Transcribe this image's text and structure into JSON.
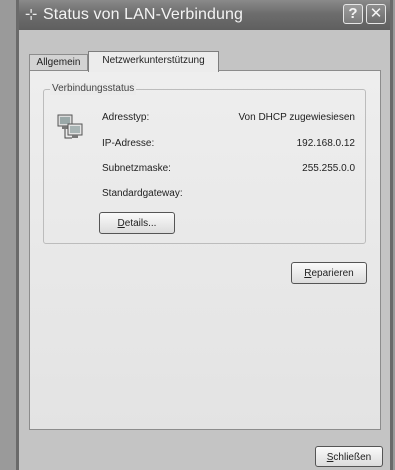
{
  "window": {
    "title": "Status von LAN-Verbindung",
    "help_label": "?",
    "close_label": "✕"
  },
  "tabs": [
    {
      "label": "Allgemein",
      "active": false
    },
    {
      "label": "Netzwerkunterstützung",
      "active": true
    }
  ],
  "connection_status": {
    "group_label": "Verbindungsstatus",
    "rows": [
      {
        "label": "Adresstyp:",
        "value": "Von DHCP zugewiesiesen"
      },
      {
        "label": "IP-Adresse:",
        "value": "192.168.0.12"
      },
      {
        "label": "Subnetzmaske:",
        "value": "255.255.0.0"
      },
      {
        "label": "Standardgateway:",
        "value": ""
      }
    ],
    "details_button": {
      "mnemonic": "D",
      "rest": "etails..."
    }
  },
  "repair_button": {
    "mnemonic": "R",
    "rest": "eparieren"
  },
  "close_button": {
    "mnemonic": "S",
    "rest": "chließen"
  }
}
